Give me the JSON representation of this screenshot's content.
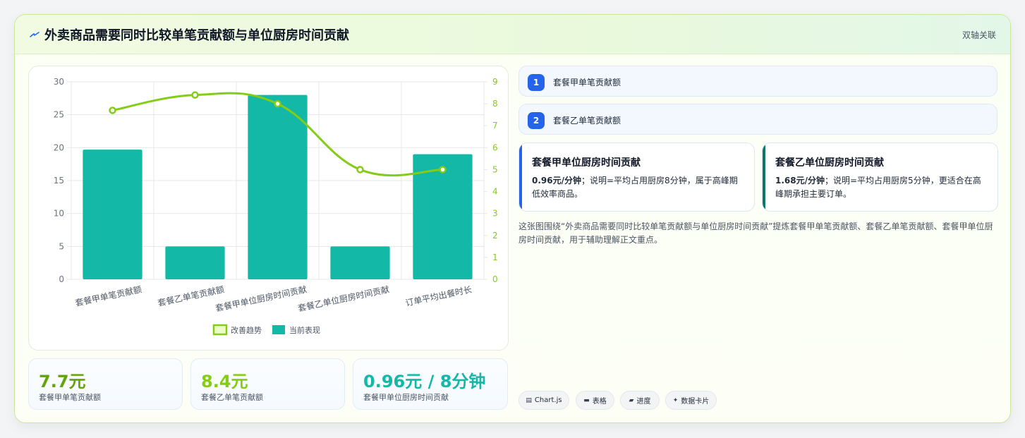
{
  "header": {
    "title": "外卖商品需要同时比较单笔贡献额与单位厨房时间贡献",
    "tag": "双轴关联"
  },
  "chart_data": {
    "type": "bar",
    "categories": [
      "套餐甲单笔贡献额",
      "套餐乙单笔贡献额",
      "套餐甲单位厨房时间贡献",
      "套餐乙单位厨房时间贡献",
      "订单平均出餐时长"
    ],
    "series": [
      {
        "name": "改善趋势",
        "type": "line",
        "axis": "right",
        "values": [
          7.7,
          8.4,
          8.0,
          5.0,
          5.0
        ],
        "color": "#84cc16"
      },
      {
        "name": "当前表现",
        "type": "bar",
        "axis": "left",
        "values": [
          19.7,
          5.0,
          28.0,
          5.0,
          19.0
        ],
        "color": "#14b8a6"
      }
    ],
    "left_axis": {
      "ylim": [
        0,
        30
      ],
      "ticks": [
        "0",
        "5",
        "10",
        "15",
        "20",
        "25",
        "30"
      ]
    },
    "right_axis": {
      "ylim": [
        0,
        9
      ],
      "ticks": [
        "0",
        "1",
        "2",
        "3",
        "4",
        "5",
        "6",
        "7",
        "8",
        "9"
      ],
      "color": "#84cc16"
    },
    "legend": "bottom",
    "grid": true
  },
  "stats": [
    {
      "value": "7.7元",
      "label": "套餐甲单笔贡献额",
      "color": "#65a30d"
    },
    {
      "value": "8.4元",
      "label": "套餐乙单笔贡献额",
      "color": "#84cc16"
    },
    {
      "value": "0.96元 / 8分钟",
      "label": "套餐甲单位厨房时间贡献",
      "color": "#14b8a6"
    }
  ],
  "list_items": [
    {
      "num": "1",
      "label": "套餐甲单笔贡献额"
    },
    {
      "num": "2",
      "label": "套餐乙单笔贡献额"
    }
  ],
  "info_cards": [
    {
      "title": "套餐甲单位厨房时间贡献",
      "lead": "0.96元/分钟",
      "body": "；说明=平均占用厨房8分钟，属于高峰期低效率商品。",
      "color": "#2563eb"
    },
    {
      "title": "套餐乙单位厨房时间贡献",
      "lead": "1.68元/分钟",
      "body": "；说明=平均占用厨房5分钟，更适合在高峰期承担主要订单。",
      "color": "#0f766e"
    }
  ],
  "summary": "这张图围绕“外卖商品需要同时比较单笔贡献额与单位厨房时间贡献”提炼套餐甲单笔贡献额、套餐乙单笔贡献额、套餐甲单位厨房时间贡献，用于辅助理解正文重点。",
  "pills": [
    {
      "icon": "chart-icon",
      "glyph": "▤",
      "label": "Chart.js"
    },
    {
      "icon": "table-icon",
      "glyph": "▬",
      "label": "表格"
    },
    {
      "icon": "progress-icon",
      "glyph": "▰",
      "label": "进度"
    },
    {
      "icon": "sparkle-icon",
      "glyph": "✦",
      "label": "数据卡片"
    }
  ]
}
